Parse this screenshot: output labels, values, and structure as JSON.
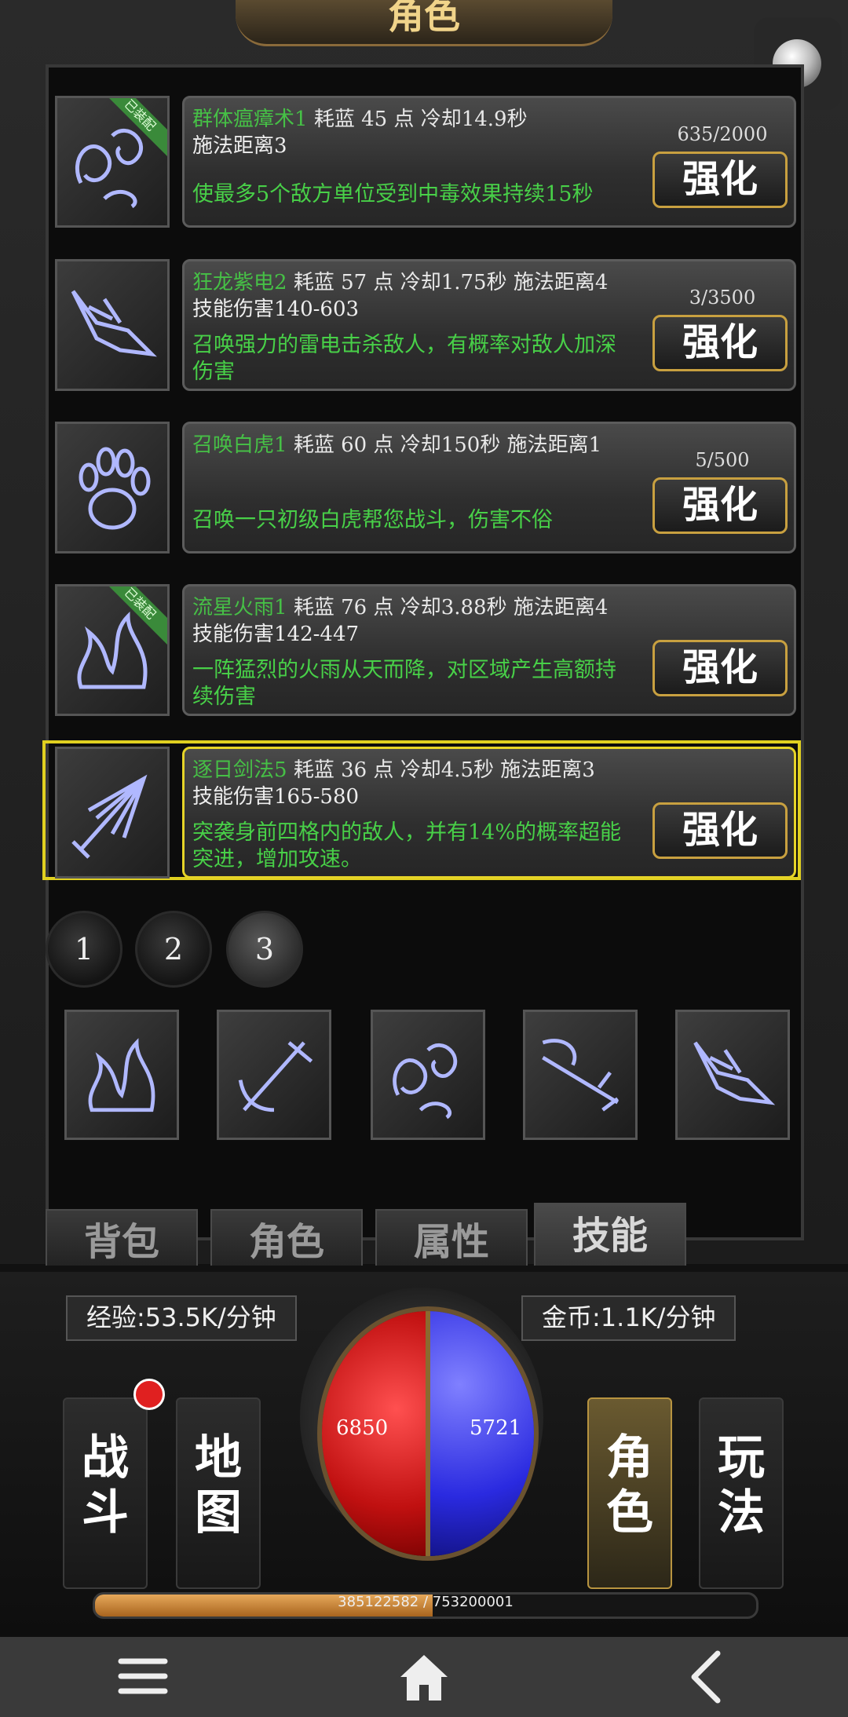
{
  "header": {
    "title": "角色"
  },
  "skills": [
    {
      "name": "群体瘟瘴术1",
      "line1": "耗蓝 45 点  冷却14.9秒",
      "line2": "施法距离3",
      "desc": "使最多5个敌方单位受到中毒效果持续15秒",
      "progress": "635/2000",
      "upgrade": "强化",
      "equipped": "已装配"
    },
    {
      "name": "狂龙紫电2",
      "line1": "耗蓝 57 点  冷却1.75秒  施法距离4",
      "line2": "技能伤害140-603",
      "desc": "召唤强力的雷电击杀敌人，有概率对敌人加深伤害",
      "progress": "3/3500",
      "upgrade": "强化",
      "equipped": ""
    },
    {
      "name": "召唤白虎1",
      "line1": "耗蓝 60 点  冷却150秒   施法距离1",
      "line2": "",
      "desc": "召唤一只初级白虎帮您战斗，伤害不俗",
      "progress": "5/500",
      "upgrade": "强化",
      "equipped": ""
    },
    {
      "name": "流星火雨1",
      "line1": "耗蓝 76 点  冷却3.88秒  施法距离4",
      "line2": "技能伤害142-447",
      "desc": "一阵猛烈的火雨从天而降，对区域产生高额持续伤害",
      "progress": "",
      "upgrade": "强化",
      "equipped": "已装配"
    },
    {
      "name": "逐日剑法5",
      "line1": "耗蓝 36 点  冷却4.5秒 施法距离3",
      "line2": "技能伤害165-580",
      "desc": "突袭身前四格内的敌人，并有14%的概率超能突进，增加攻速。",
      "progress": "",
      "upgrade": "强化",
      "equipped": ""
    }
  ],
  "pages": [
    "1",
    "2",
    "3"
  ],
  "slots": [
    "fire-rain-icon",
    "sword-icon",
    "poison-cloud-icon",
    "sword-strike-icon",
    "dragon-icon"
  ],
  "tabs": [
    "背包",
    "角色",
    "属性",
    "技能"
  ],
  "rates": {
    "exp": "经验:53.5K/分钟",
    "gold": "金币:1.1K/分钟"
  },
  "orb": {
    "hp": "6850",
    "mp": "5721"
  },
  "nav": {
    "battle": [
      "战",
      "斗"
    ],
    "map": [
      "地",
      "图"
    ],
    "role": [
      "角",
      "色"
    ],
    "play": [
      "玩",
      "法"
    ]
  },
  "xp": {
    "text": "385122582 / 753200001",
    "fraction": 0.511
  },
  "colors": {
    "skill_name": "#46c046",
    "desc": "#48d048",
    "highlight": "#e0d020",
    "hp": "#d01818",
    "mp": "#2a2ae0"
  }
}
